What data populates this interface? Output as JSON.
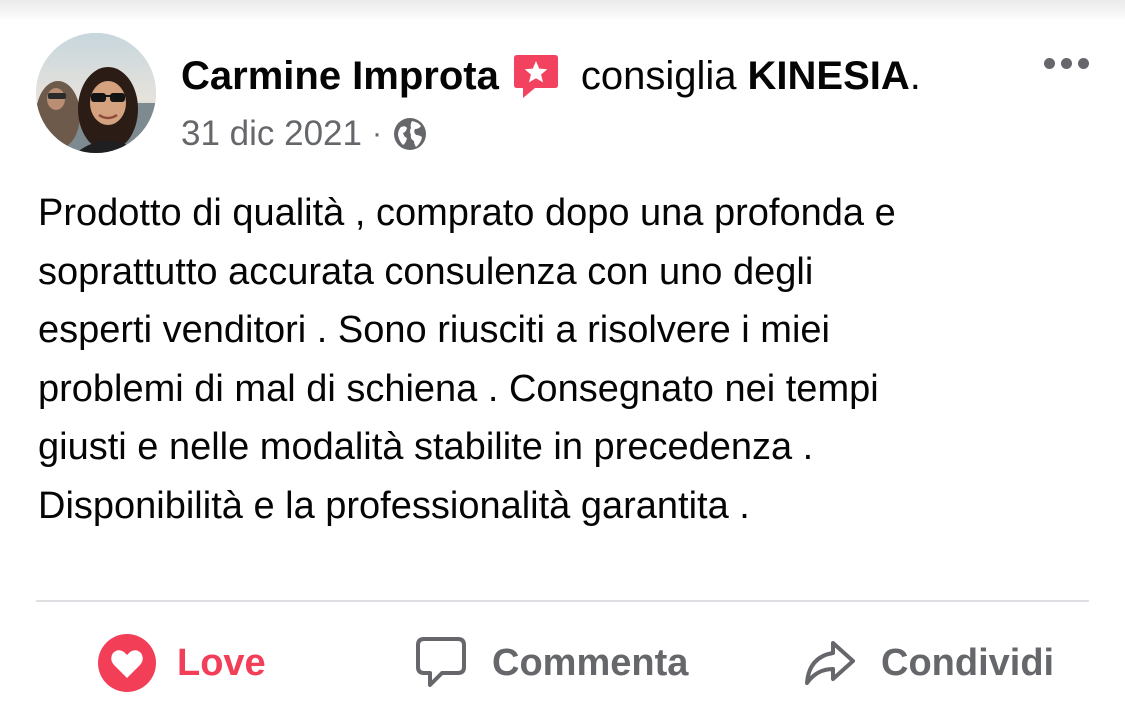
{
  "post": {
    "author": "Carmine Improta",
    "verb": "consiglia",
    "page": "KINESIA",
    "period": ".",
    "date": "31 dic 2021",
    "separator": "·",
    "text": "Prodotto di qualità , comprato dopo una profonda e\nsoprattutto accurata consulenza con uno degli\nesperti venditori . Sono riusciti a risolvere i miei\nproblemi di mal di schiena .  Consegnato nei tempi\ngiusti e nelle modalità stabilite in precedenza .\nDisponibilità e la professionalità garantita ."
  },
  "icons": {
    "avatar": "avatar-photo",
    "recommendation": "recommendation-badge-icon",
    "privacy": "globe-icon",
    "more": "more-options-icon"
  },
  "actions": {
    "love_label": "Love",
    "comment_label": "Commenta",
    "share_label": "Condividi"
  },
  "colors": {
    "love": "#f33e58",
    "recommendation_badge": "#f3425f",
    "secondary_text": "#65676b",
    "divider": "#dddfe2"
  }
}
